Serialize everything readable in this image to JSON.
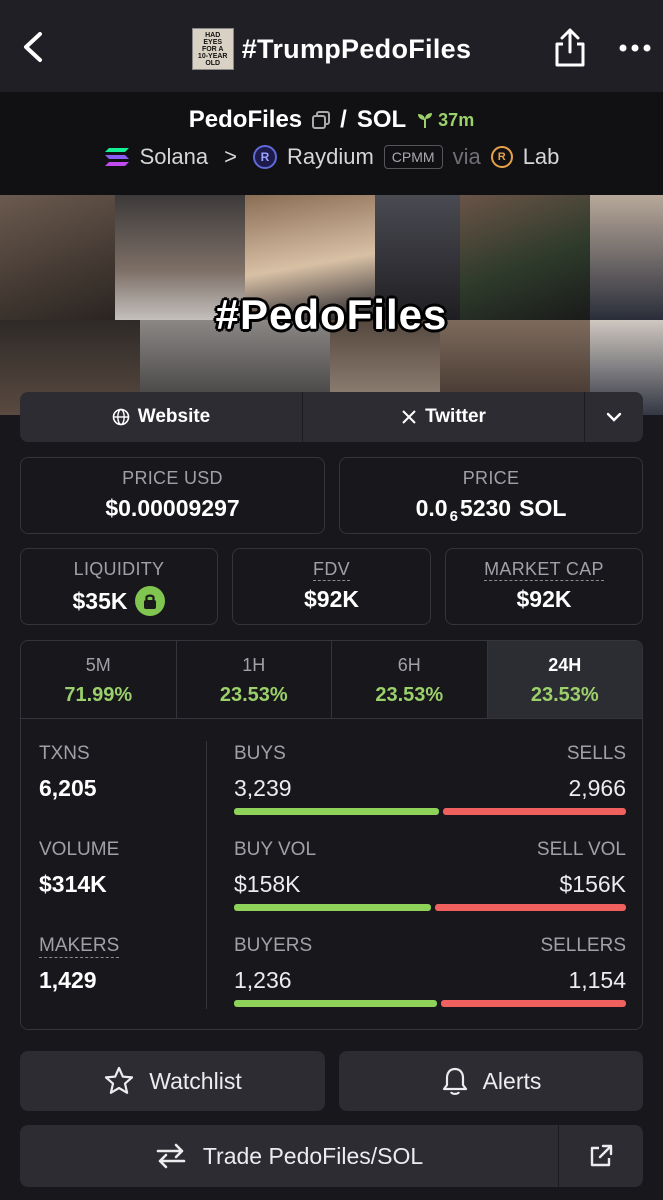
{
  "header": {
    "title": "#TrumpPedoFiles",
    "thumb_lines": [
      "HAD",
      "EYES",
      "FOR A",
      "10-YEAR OLD"
    ]
  },
  "pair": {
    "base": "PedoFiles",
    "separator": "/",
    "quote": "SOL",
    "age": "37m",
    "chain": "Solana",
    "chevron": ">",
    "dex": "Raydium",
    "pool_type": "CPMM",
    "via": "via",
    "launchpad": "Lab"
  },
  "banner": {
    "caption": "#PedoFiles"
  },
  "links": {
    "website": "Website",
    "twitter": "Twitter"
  },
  "prices": {
    "price_usd_label": "PRICE USD",
    "price_usd": "$0.00009297",
    "price_label": "PRICE",
    "price_prefix": "0.0",
    "price_zeros": "6",
    "price_digits": "5230",
    "price_unit": "SOL"
  },
  "metrics": {
    "liquidity_label": "LIQUIDITY",
    "liquidity": "$35K",
    "fdv_label": "FDV",
    "fdv": "$92K",
    "mcap_label": "MARKET CAP",
    "mcap": "$92K"
  },
  "timeframes": [
    {
      "label": "5M",
      "value": "71.99%"
    },
    {
      "label": "1H",
      "value": "23.53%"
    },
    {
      "label": "6H",
      "value": "23.53%"
    },
    {
      "label": "24H",
      "value": "23.53%"
    }
  ],
  "active_timeframe": "24H",
  "stats": {
    "txns_label": "TXNS",
    "txns": "6,205",
    "buys_label": "BUYS",
    "buys": "3,239",
    "sells_label": "SELLS",
    "sells": "2,966",
    "volume_label": "VOLUME",
    "volume": "$314K",
    "buy_vol_label": "BUY VOL",
    "buy_vol": "$158K",
    "sell_vol_label": "SELL VOL",
    "sell_vol": "$156K",
    "makers_label": "MAKERS",
    "makers": "1,429",
    "buyers_label": "BUYERS",
    "buyers": "1,236",
    "sellers_label": "SELLERS",
    "sellers": "1,154",
    "buy_share_txns": 0.522,
    "buy_share_volume": 0.503,
    "buy_share_makers": 0.517
  },
  "actions": {
    "watchlist": "Watchlist",
    "alerts": "Alerts",
    "trade": "Trade PedoFiles/SOL"
  },
  "colors": {
    "positive": "#9bd06b",
    "buy_bar": "#8fd25a",
    "sell_bar": "#f0605e",
    "background": "#17171c"
  }
}
